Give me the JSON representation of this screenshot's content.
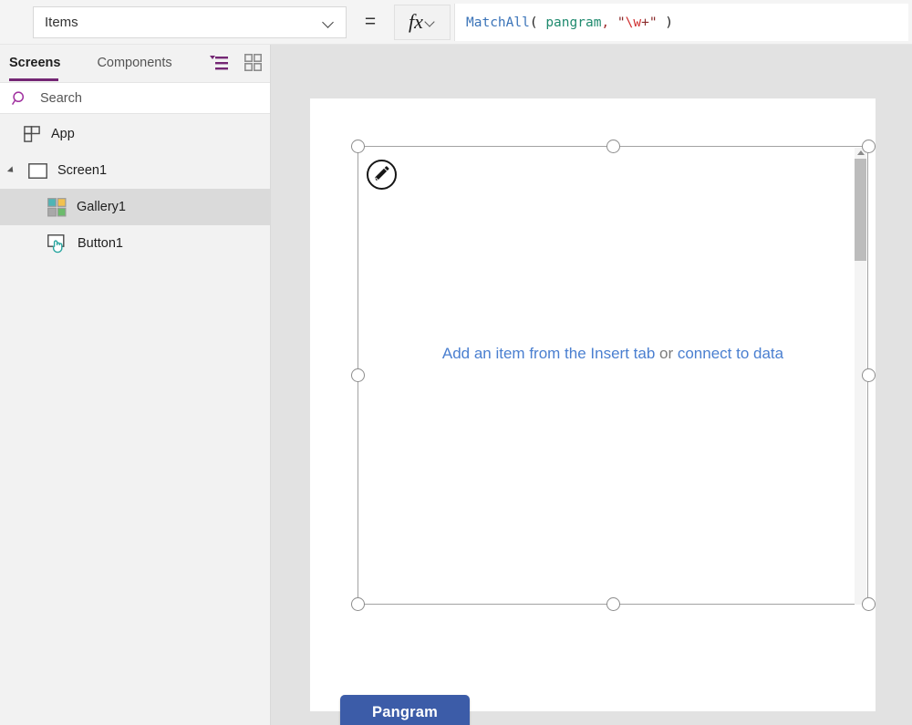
{
  "formula_bar": {
    "property_label": "Items",
    "property_dropdown_icon": "chevron-down-icon",
    "equals_sign": "=",
    "fx_label": "fx",
    "fx_dropdown_icon": "chevron-down-icon",
    "formula_tokens": [
      {
        "text": "MatchAll",
        "type": "fn"
      },
      {
        "text": "( ",
        "type": "paren"
      },
      {
        "text": "pangram",
        "type": "ident"
      },
      {
        "text": ",",
        "type": "punct"
      },
      {
        "text": " ",
        "type": "plain"
      },
      {
        "text": "\"",
        "type": "str"
      },
      {
        "text": "\\w",
        "type": "esc"
      },
      {
        "text": "+\"",
        "type": "str"
      },
      {
        "text": " )",
        "type": "paren"
      }
    ],
    "formula_plain": "MatchAll( pangram, \"\\w+\" )"
  },
  "left_panel": {
    "tabs": [
      {
        "label": "Screens",
        "active": true
      },
      {
        "label": "Components",
        "active": false
      }
    ],
    "view_icons": [
      {
        "name": "tree-view-icon",
        "active": true
      },
      {
        "name": "tile-view-icon",
        "active": false
      }
    ],
    "search": {
      "placeholder": "Search",
      "value": "",
      "icon": "search-icon"
    },
    "tree": [
      {
        "label": "App",
        "icon": "app-icon",
        "depth": 0,
        "selected": false,
        "expandable": false
      },
      {
        "label": "Screen1",
        "icon": "screen-icon",
        "depth": 0,
        "selected": false,
        "expandable": true,
        "expanded": true
      },
      {
        "label": "Gallery1",
        "icon": "gallery-icon",
        "depth": 1,
        "selected": true,
        "expandable": false
      },
      {
        "label": "Button1",
        "icon": "button-icon",
        "depth": 1,
        "selected": false,
        "expandable": false
      }
    ]
  },
  "canvas": {
    "gallery": {
      "selected": true,
      "edit_badge_icon": "pencil-icon",
      "empty_text_parts": [
        {
          "text": "Add an item from the Insert tab",
          "style": "link"
        },
        {
          "text": " or ",
          "style": "muted"
        },
        {
          "text": "connect to data",
          "style": "link"
        }
      ],
      "scrollbar": {
        "up_arrow_icon": "scroll-up-arrow-icon",
        "thumb_visible": true
      },
      "handles": [
        "top-left",
        "top-center",
        "top-right",
        "middle-left",
        "middle-right",
        "bottom-left",
        "bottom-center",
        "bottom-right"
      ]
    },
    "button": {
      "label": "Pangram"
    }
  },
  "colors": {
    "accent_purple": "#742774",
    "link_blue": "#4a7fd0",
    "button_blue": "#3c5ca8",
    "canvas_gray": "#e2e2e2",
    "panel_gray": "#f2f2f2",
    "selected_row": "#dadada",
    "gallery_icon_teal": "#4fb5b5",
    "gallery_icon_orange": "#f2c14e",
    "gallery_icon_gray": "#a8a8a8",
    "gallery_icon_green": "#6cbb6c",
    "formula_fn": "#3a73b8",
    "formula_ident": "#1f8a6e",
    "formula_string": "#8a2b2b",
    "formula_escape": "#d03030"
  }
}
